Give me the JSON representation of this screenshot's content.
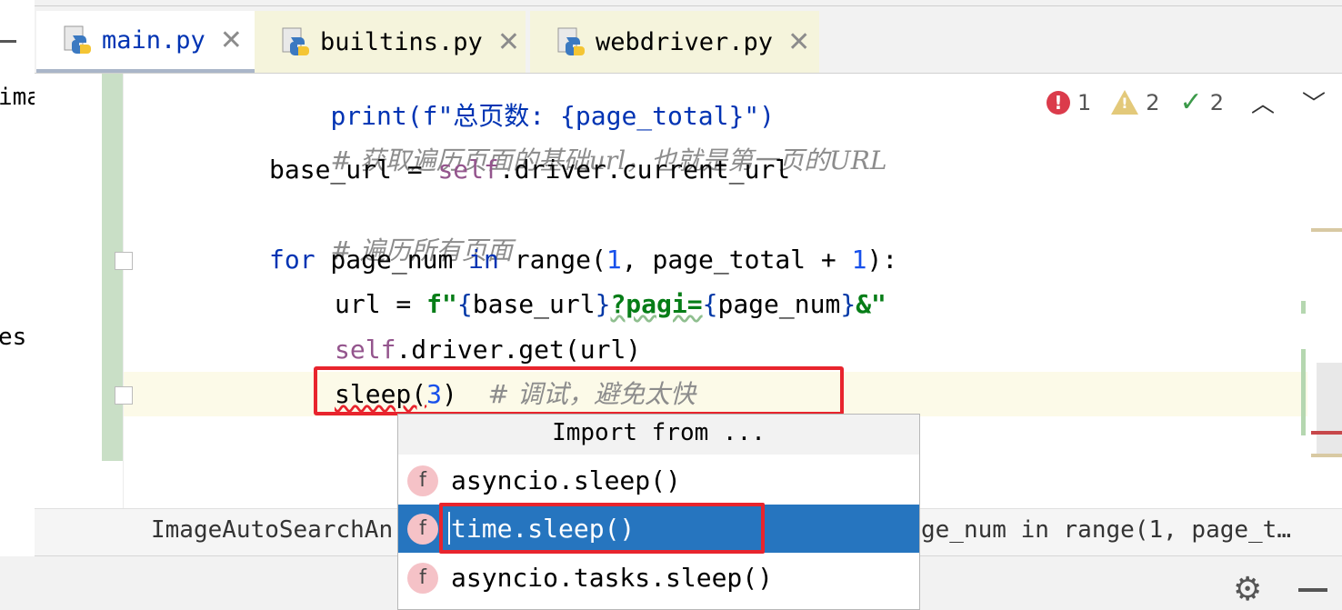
{
  "left_strip": {
    "fragment_top": "ima",
    "fragment_mid": "es"
  },
  "tabs": [
    {
      "label": "main.py",
      "icon": "python-file-icon",
      "active": true
    },
    {
      "label": "builtins.py",
      "icon": "python-file-icon",
      "active": false
    },
    {
      "label": "webdriver.py",
      "icon": "python-file-icon",
      "active": false
    }
  ],
  "inspections": {
    "errors": "1",
    "warnings": "2",
    "weak_warnings": "2"
  },
  "code": {
    "line1": "print(f\"总页数: {page_total}\")",
    "line2_comment": "# 获取遍历页面的基础url，也就是第一页的URL",
    "line3_a": "base_url = ",
    "line3_self": "self",
    "line3_b": ".driver.current_url",
    "line4_comment": "# 遍历所有页面",
    "line5_for": "for",
    "line5_a": " page_num ",
    "line5_in": "in",
    "line5_b": " range(",
    "line5_n1": "1",
    "line5_c": ", page_total + ",
    "line5_n2": "1",
    "line5_d": "):",
    "line6_a": "url = ",
    "line6_f": "f\"",
    "line6_b1": "{",
    "line6_v1": "base_url",
    "line6_b2": "}",
    "line6_q": "?pagi=",
    "line6_b3": "{",
    "line6_v2": "page_num",
    "line6_b4": "}",
    "line6_end": "&\"",
    "line7_self": "self",
    "line7_rest": ".driver.get(url)",
    "line8_a": "sleep(",
    "line8_n": "3",
    "line8_b": ")  ",
    "line8_comment": "# 调试，避免太快"
  },
  "breadcrumb": {
    "left": "ImageAutoSearchAn",
    "right": "ge_num in range(1, page_t…"
  },
  "popup": {
    "title": "Import from ...",
    "items": [
      {
        "label": "asyncio.sleep()",
        "icon_letter": "f",
        "selected": false
      },
      {
        "label": "time.sleep()",
        "icon_letter": "f",
        "selected": true
      },
      {
        "label": "asyncio.tasks.sleep()",
        "icon_letter": "f",
        "selected": false
      }
    ]
  },
  "colors": {
    "highlight_red": "#e8242d",
    "selection_blue": "#2675bf",
    "keyword_blue": "#0033b3"
  }
}
